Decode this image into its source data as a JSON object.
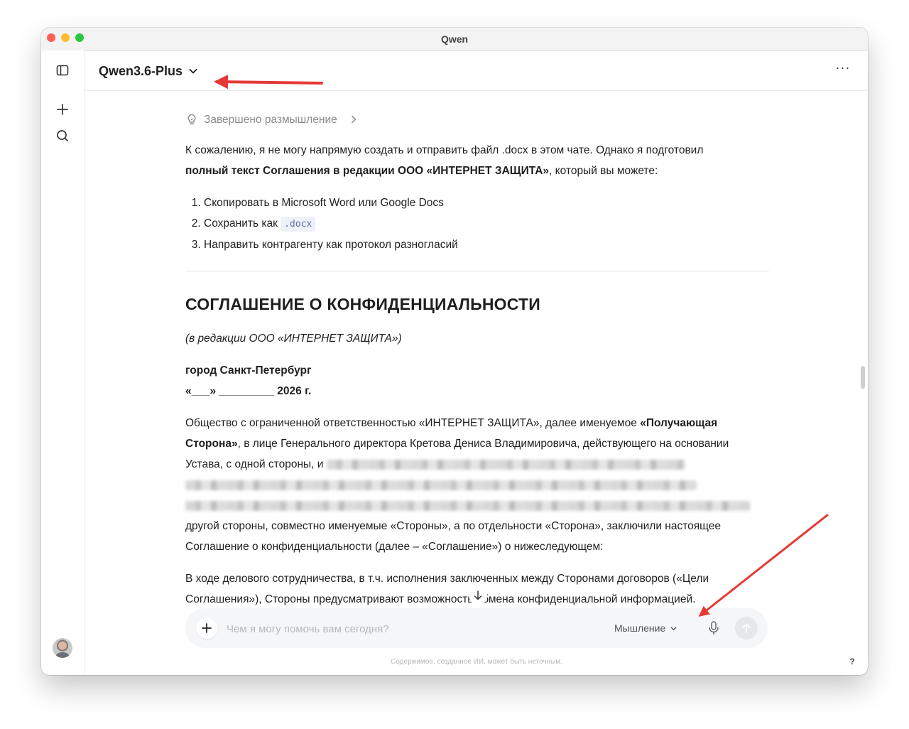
{
  "window": {
    "title": "Qwen"
  },
  "sidebar": {
    "toggle_icon": "sidebar-toggle-icon",
    "new_chat_icon": "plus-icon",
    "search_icon": "search-icon",
    "avatar_icon": "user-avatar"
  },
  "header": {
    "model_name": "Qwen3.6-Plus",
    "model_dropdown_icon": "chevron-down-icon",
    "more_icon": "ellipsis-icon",
    "more_glyph": "···"
  },
  "message": {
    "thinking_label": "Завершено размышление",
    "intro_text_1": "К сожалению, я не могу напрямую создать и отправить файл .docx в этом чате. Однако я подготовил",
    "intro_bold": "полный текст Соглашения в редакции ООО «ИНТЕРНЕТ ЗАЩИТА»",
    "intro_text_2": ", который вы можете:",
    "steps": [
      "Скопировать в Microsoft Word или Google Docs",
      "Сохранить как",
      "Направить контрагенту как протокол разногласий"
    ],
    "steps_code": ".docx",
    "doc_title": "СОГЛАШЕНИЕ О КОНФИДЕНЦИАЛЬНОСТИ",
    "doc_subtitle": "(в редакции ООО «ИНТЕРНЕТ ЗАЩИТА»)",
    "city": "город Санкт-Петербург",
    "date": "«___» _________ 2026 г.",
    "para1_a": "Общество с ограниченной ответственностью «ИНТЕРНЕТ ЗАЩИТА», далее именуемое ",
    "para1_b": "«Получающая Сторона»",
    "para1_c": ", в лице Генерального директора Кретова Дениса Владимировича, действующего на основании Устава, с одной стороны, и",
    "para1_d": "другой стороны, совместно именуемые «Стороны», а по отдельности «Сторона», заключили настоящее Соглашение о конфиденциальности (далее – «Соглашение») о нижеследующем:",
    "para2": "В ходе делового сотрудничества, в т.ч. исполнения заключенных между Сторонами договоров («Цели Соглашения»), Стороны предусматривают возможность обмена конфиденциальной информацией."
  },
  "composer": {
    "placeholder": "Чем я могу помочь вам сегодня?",
    "mode_label": "Мышление",
    "plus_icon": "plus-icon",
    "mic_icon": "microphone-icon",
    "send_icon": "arrow-up-icon"
  },
  "footer": {
    "disclaimer": "Содержимое, созданное ИИ, может быть неточным.",
    "help": "?"
  },
  "colors": {
    "annotation_arrow": "#e53935",
    "accent_code": "#5a6fb5"
  }
}
